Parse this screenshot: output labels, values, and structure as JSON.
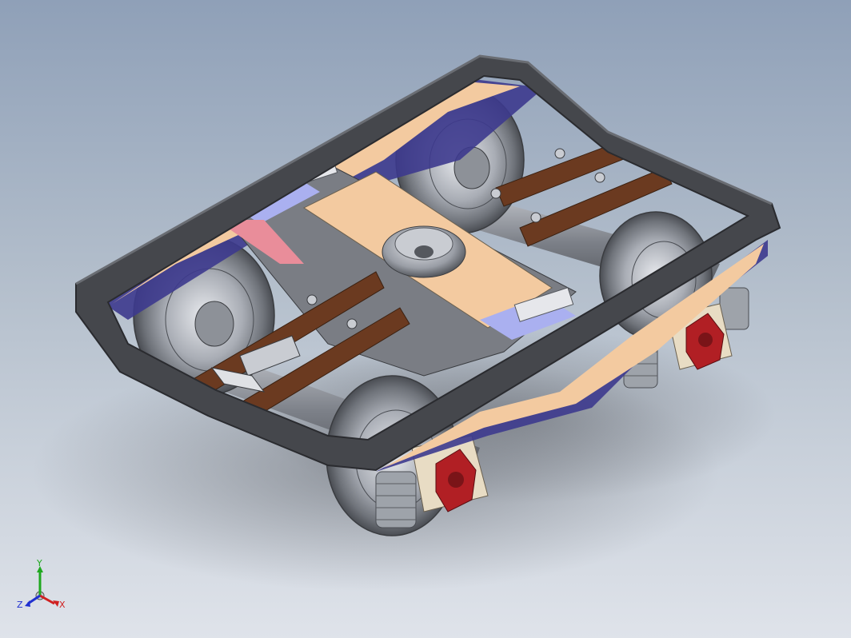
{
  "viewport": {
    "background_top": "#8fa0b8",
    "background_bottom": "#dfe3ea"
  },
  "model": {
    "description_icon": "bogie-3d-model",
    "colors": {
      "frame_dark": "#45474c",
      "frame_edge": "#2a2b2f",
      "bolster_tan": "#f3caa0",
      "side_blue": "#3d3a8e",
      "lavender": "#aab0f0",
      "pink": "#e98d9a",
      "brake_beam_brown": "#6b3a20",
      "wheel_gray": "#9ea3aa",
      "axle_gray": "#7c8088",
      "bearing_cover_red": "#b11f24",
      "bearing_body": "#e8dcc4"
    }
  },
  "triad": {
    "y_label": "Y",
    "z_label": "Z",
    "x_label": "X",
    "y_color": "#1fa81f",
    "z_color": "#2030d0",
    "x_color": "#d02020"
  }
}
